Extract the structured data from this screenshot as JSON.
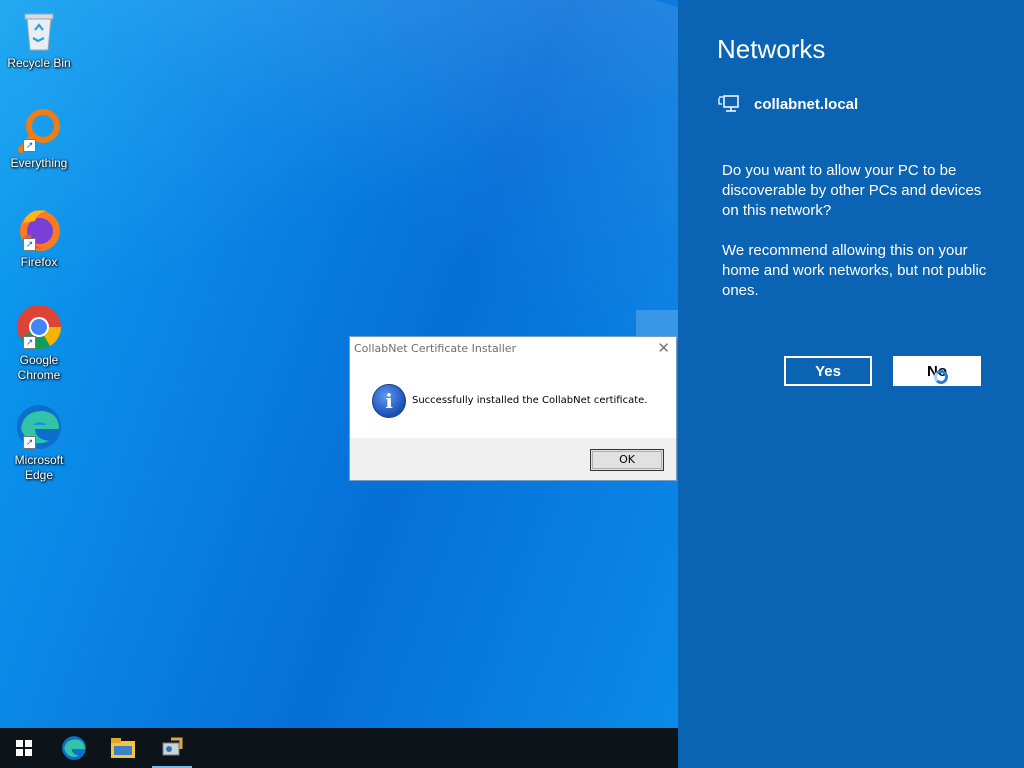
{
  "desktop": {
    "icons": [
      {
        "label": "Recycle Bin",
        "icon": "recycle-bin-icon"
      },
      {
        "label": "Everything",
        "icon": "everything-search-icon"
      },
      {
        "label": "Firefox",
        "icon": "firefox-icon"
      },
      {
        "label": "Google Chrome",
        "icon": "chrome-icon"
      },
      {
        "label": "Microsoft Edge",
        "icon": "edge-icon"
      }
    ]
  },
  "taskbar": {
    "items": [
      "windows-start-icon",
      "edge-icon",
      "file-explorer-icon",
      "certificate-installer-icon"
    ]
  },
  "networks": {
    "title": "Networks",
    "network_name": "collabnet.local",
    "question": "Do you want to allow your PC to be discoverable by other PCs and devices on this network?",
    "recommendation": "We recommend allowing this on your home and work networks, but not public ones.",
    "yes_label": "Yes",
    "no_label": "No"
  },
  "dialog": {
    "title": "CollabNet Certificate Installer",
    "message": "Successfully installed the CollabNet certificate.",
    "ok_label": "OK",
    "icon": "info-icon"
  },
  "colors": {
    "flyout_bg": "#0a64b3",
    "taskbar_bg": "#0d1419",
    "desktop_accent": "#0a86e6"
  }
}
